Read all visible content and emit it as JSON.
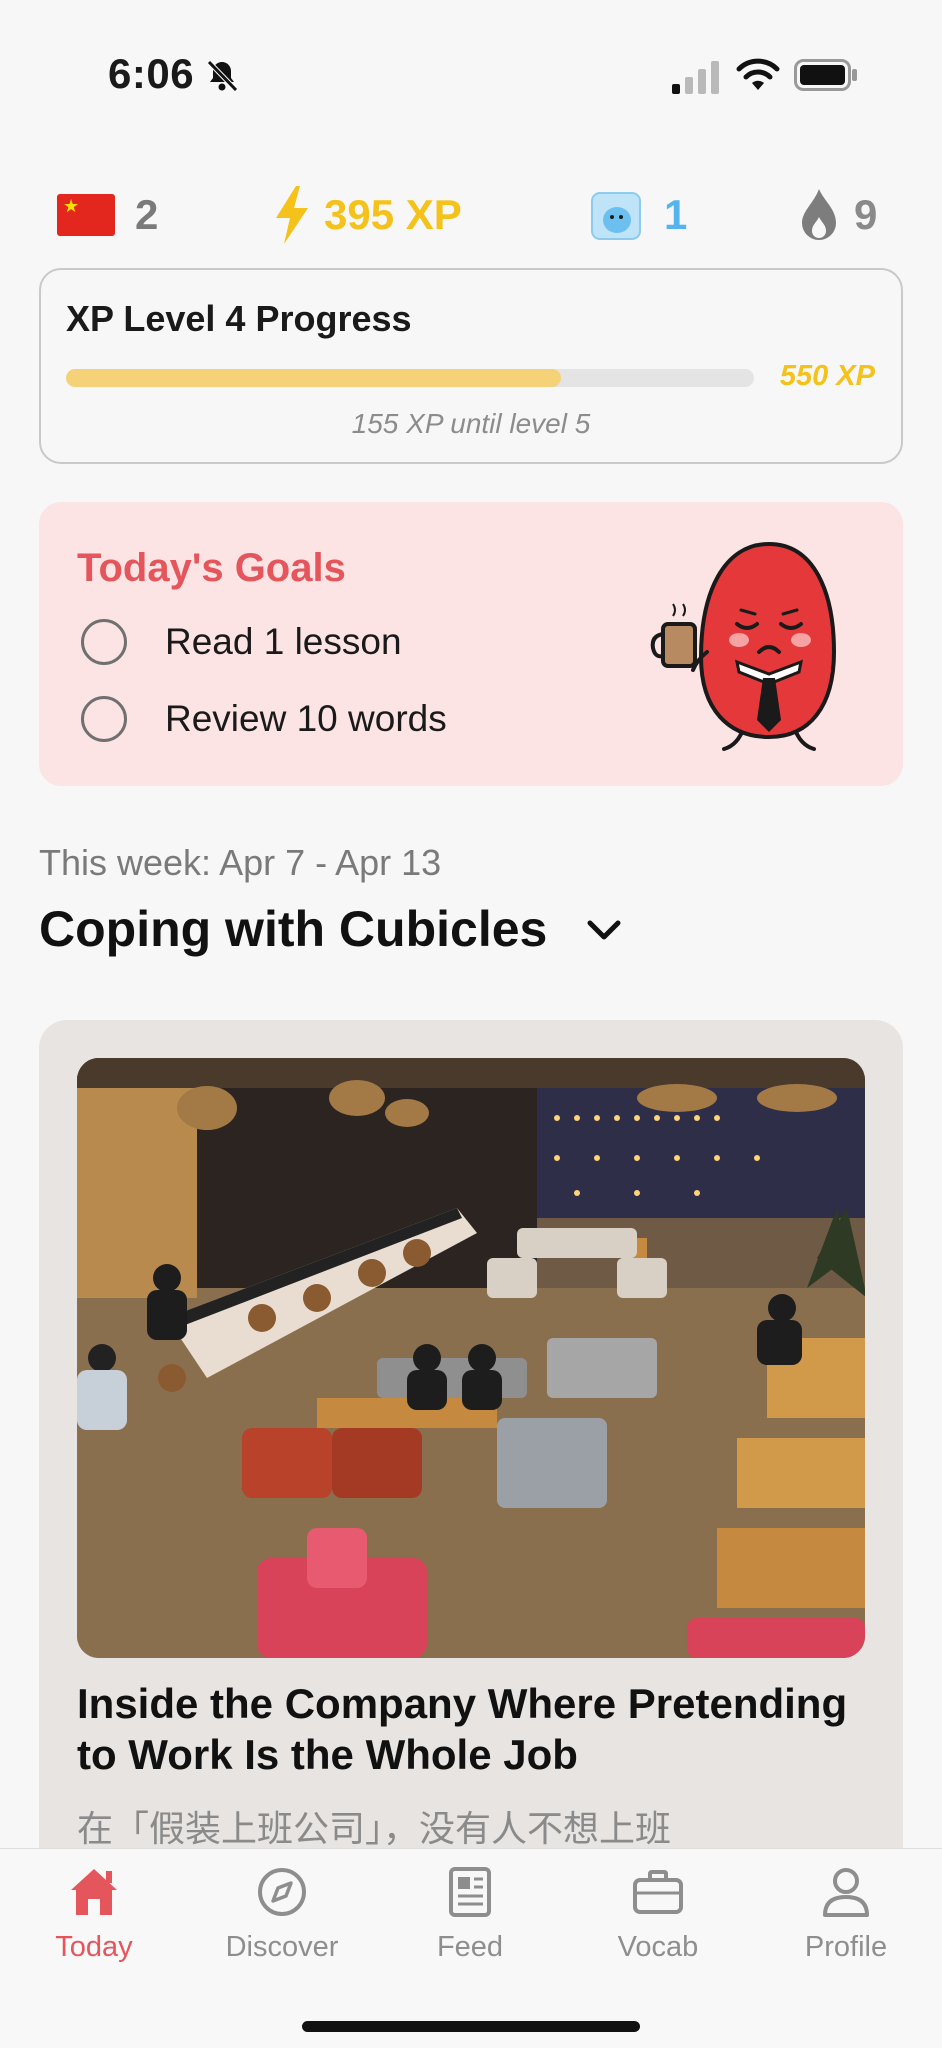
{
  "status_bar": {
    "time": "6:06"
  },
  "stats": {
    "language_count": "2",
    "xp": "395 XP",
    "gems": "1",
    "streak": "9"
  },
  "xp_card": {
    "title": "XP Level 4 Progress",
    "progress_fraction": 0.72,
    "goal_label": "550 XP",
    "remaining_label": "155 XP until level 5"
  },
  "goals": {
    "title": "Today's Goals",
    "items": [
      {
        "label": "Read 1 lesson",
        "done": false
      },
      {
        "label": "Review 10 words",
        "done": false
      }
    ]
  },
  "week": {
    "range": "This week: Apr 7 - Apr 13",
    "title": "Coping with Cubicles"
  },
  "article": {
    "title": "Inside the Company Where Pretending to Work Is the Whole Job",
    "subtitle": "在「假装上班公司」，没有人不想上班"
  },
  "tabs": [
    {
      "label": "Today",
      "icon": "home-icon",
      "active": true
    },
    {
      "label": "Discover",
      "icon": "compass-icon",
      "active": false
    },
    {
      "label": "Feed",
      "icon": "newspaper-icon",
      "active": false
    },
    {
      "label": "Vocab",
      "icon": "briefcase-icon",
      "active": false
    },
    {
      "label": "Profile",
      "icon": "person-icon",
      "active": false
    }
  ],
  "colors": {
    "accent_red": "#e4565c",
    "xp_yellow": "#f4c21a",
    "gem_blue": "#56b4ec",
    "goals_bg": "#fce4e4",
    "progress_fill": "#f5d277"
  }
}
